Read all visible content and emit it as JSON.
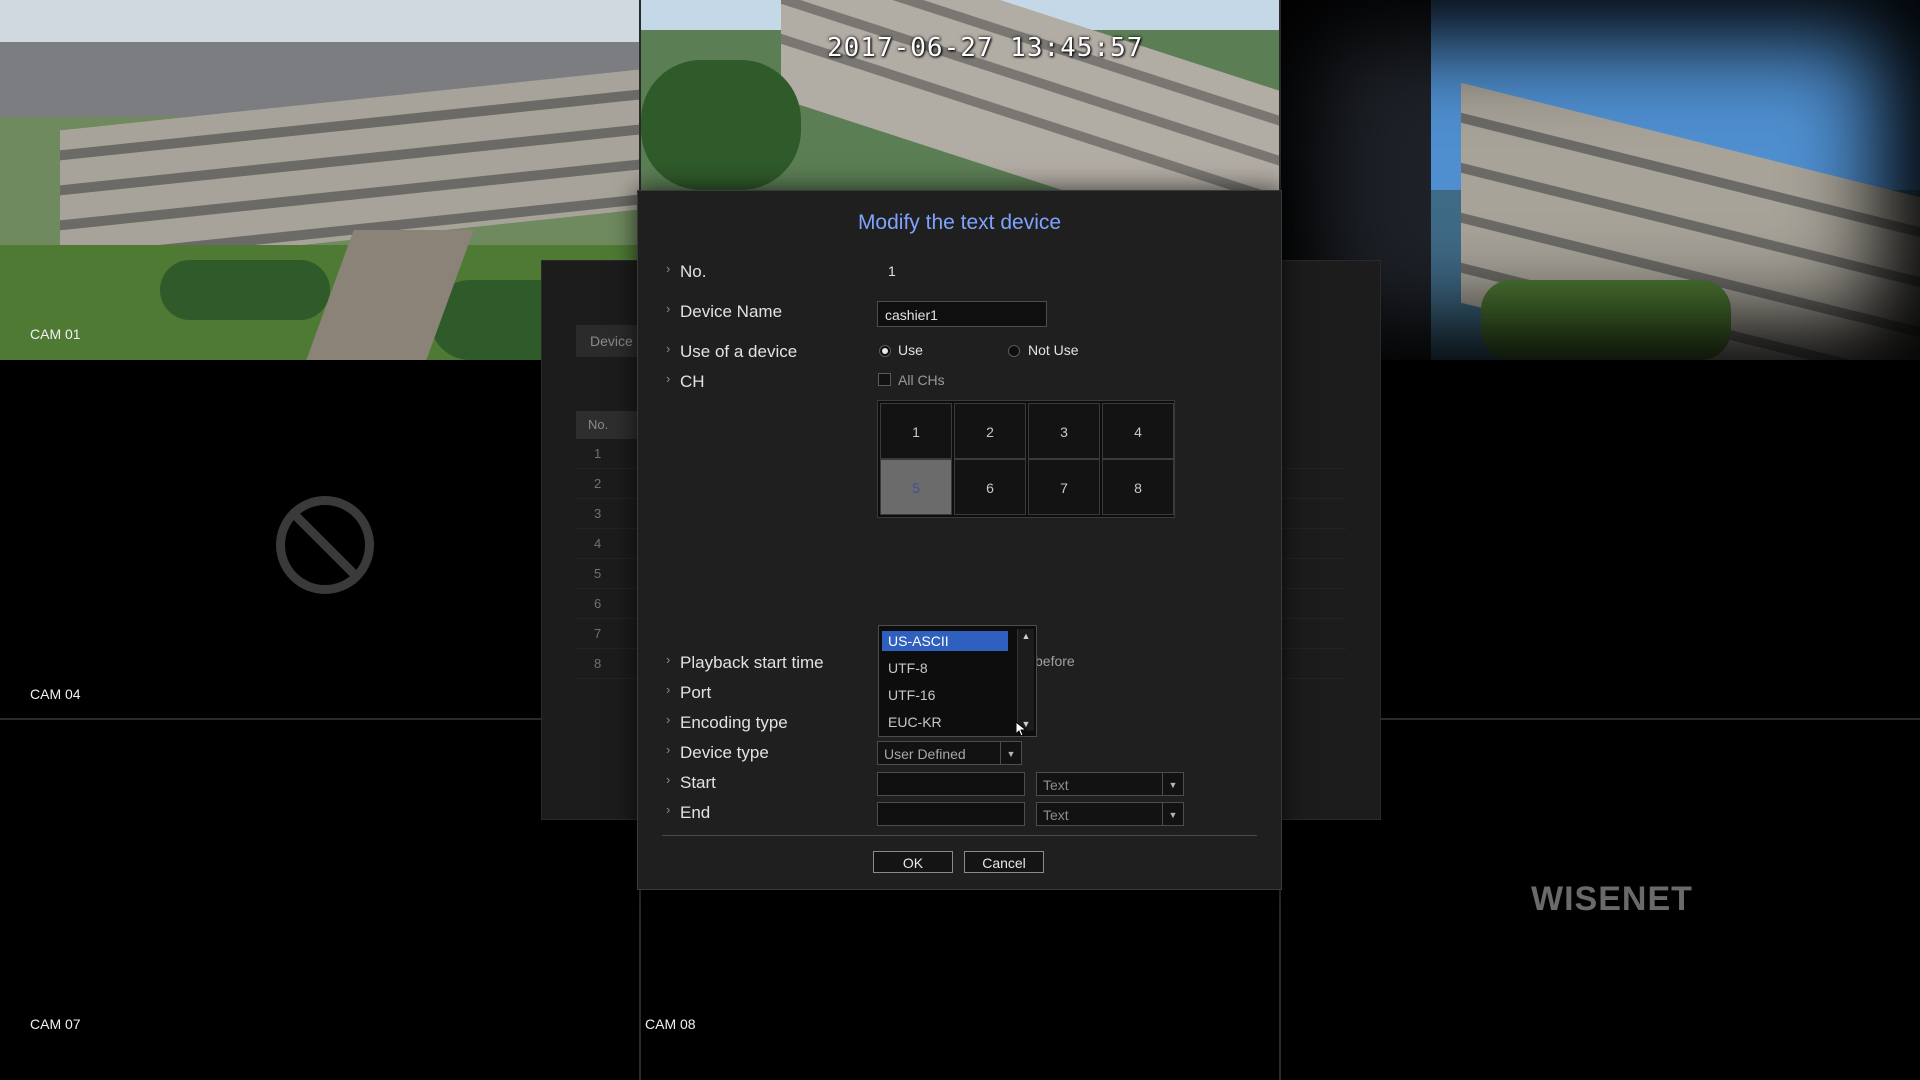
{
  "cameras": {
    "cam01": "CAM 01",
    "cam04": "CAM 04",
    "cam07": "CAM 07",
    "cam08": "CAM 08"
  },
  "overlay": {
    "timestamp": "2017-06-27 13:45:57",
    "brand": "WISENET"
  },
  "background_panel": {
    "tab": "Device",
    "column_no": "No.",
    "rows": [
      "1",
      "2",
      "3",
      "4",
      "5",
      "6",
      "7",
      "8"
    ]
  },
  "dialog": {
    "title": "Modify the text device",
    "labels": {
      "no": "No.",
      "device_name": "Device Name",
      "use_of_device": "Use of a device",
      "ch": "CH",
      "playback_start_time": "Playback start time",
      "port": "Port",
      "encoding_type": "Encoding type",
      "device_type": "Device type",
      "start": "Start",
      "end": "End"
    },
    "values": {
      "no": "1",
      "device_name": "cashier1",
      "use": "Use",
      "not_use": "Not Use",
      "all_chs": "All CHs",
      "before": "before",
      "device_type": "User Defined",
      "start_type": "Text",
      "end_type": "Text"
    },
    "channels": [
      "1",
      "2",
      "3",
      "4",
      "5",
      "6",
      "7",
      "8"
    ],
    "selected_channel": "5",
    "encoding_options": [
      "US-ASCII",
      "UTF-8",
      "UTF-16",
      "EUC-KR"
    ],
    "selected_encoding": "US-ASCII",
    "buttons": {
      "ok": "OK",
      "cancel": "Cancel"
    }
  }
}
